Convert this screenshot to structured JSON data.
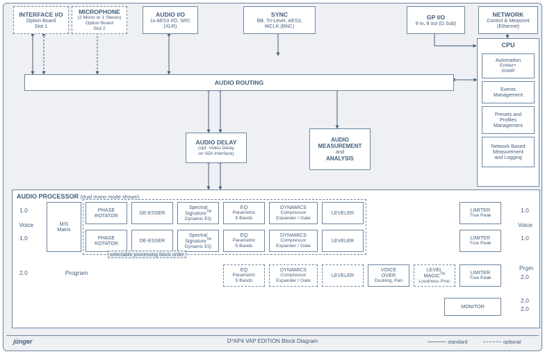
{
  "top": {
    "interface_io": {
      "title": "INTERFACE I/O",
      "line1": "Option Board",
      "line2": "Slot 1"
    },
    "microphone": {
      "title": "MICROPHONE",
      "line1": "(2 Mono or 1 Stereo)",
      "line2": "Option Board",
      "line3": "Slot 2"
    },
    "audio_io": {
      "title": "AUDIO I/O",
      "line1": "1x AES3 I/O, SRC",
      "line2": "(XLR)"
    },
    "sync": {
      "title": "SYNC",
      "line1": "BB, Tri-Level, AES3,",
      "line2": "WCLK (BNC)"
    },
    "gpio": {
      "title": "GP I/O",
      "line1": "8 in, 8 out (D.Sub)"
    },
    "network": {
      "title": "NETWORK",
      "line1": "Control & Measmnt",
      "line2": "(Ethernet)"
    }
  },
  "mid": {
    "routing": {
      "title": "AUDIO ROUTING"
    },
    "delay": {
      "title": "AUDIO DELAY",
      "line1": "(opt. Video Delay",
      "line2": "on SDI Interface)"
    },
    "measure": {
      "title": "AUDIO",
      "line1": "MEASUREMENT",
      "line2": "and",
      "line3": "ANALYSIS"
    }
  },
  "side": {
    "cpu": "CPU",
    "automation": {
      "title": "Automation",
      "line1": "Ember+",
      "line2": "SNMP"
    },
    "events": {
      "title": "Events",
      "line1": "Management"
    },
    "presets": {
      "title": "Presets and",
      "line1": "Profiles",
      "line2": "Management"
    },
    "netmeas": {
      "title": "Network Based",
      "line1": "Measurement",
      "line2": "and Logging"
    }
  },
  "proc": {
    "section_title": "AUDIO PROCESSOR",
    "section_sub": "(dual mono mode shown)",
    "labels": {
      "in1": "1.0",
      "in2": "1.0",
      "in3": "2.0",
      "voice_in": "Voice",
      "program": "Program",
      "out1": "1.0",
      "out2": "1.0",
      "out3": "Prgm",
      "out3b": "2.0",
      "out4": "2.0",
      "out5": "2.0",
      "voice_out": "Voice"
    },
    "ms": {
      "title": "M/S",
      "line1": "Matrix"
    },
    "phase": {
      "title": "PHASE",
      "line1": "ROTATOR"
    },
    "deesser": {
      "title": "DE-ESSER"
    },
    "spectral": {
      "title": "Spectral",
      "tm": "Signature",
      "line1": "Dynamic EQ"
    },
    "eq": {
      "title": "EQ",
      "line1": "Parametric",
      "line2": "5 Bands"
    },
    "dyn": {
      "title": "DYNAMICS",
      "line1": "Compressor",
      "line2": "Expander / Gate"
    },
    "leveler": {
      "title": "LEVELER"
    },
    "limiter": {
      "title": "LIMITER",
      "line1": "True Peak"
    },
    "vo": {
      "title": "VOICE",
      "line1": "OVER",
      "line2": "Ducking, Pan"
    },
    "lmagic": {
      "title": "LEVEL",
      "tm": "MAGIC",
      "line1": "Loudness Proc"
    },
    "monitor": {
      "title": "MONITOR"
    },
    "pipe_note": "selectable processing block order"
  },
  "footer": {
    "brand": "jünger",
    "caption": "D*AP4 VAP EDITION Block Diagram",
    "legend_std": "standard",
    "legend_opt": "optional"
  }
}
